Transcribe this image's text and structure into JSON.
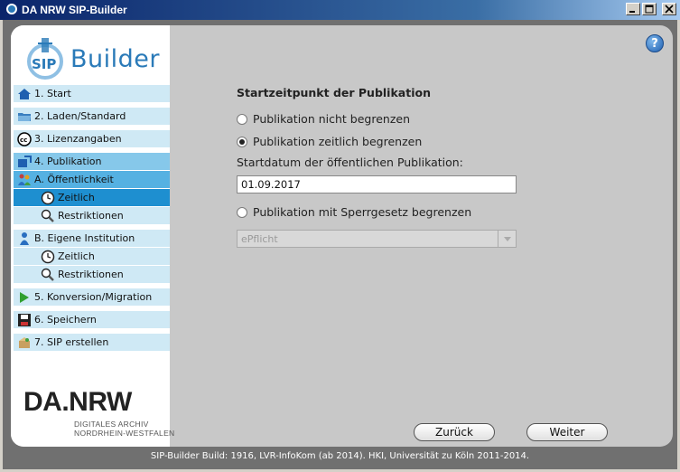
{
  "window": {
    "title": "DA NRW SIP-Builder"
  },
  "sidebar": {
    "logo_text": "Builder",
    "logo_sip": "SIP",
    "items": [
      {
        "label": "1. Start",
        "icon": "house-icon"
      },
      {
        "label": "2. Laden/Standard",
        "icon": "folder-icon"
      },
      {
        "label": "3. Lizenzangaben",
        "icon": "creative-commons-icon"
      },
      {
        "label": "4. Publikation",
        "icon": "publish-icon"
      },
      {
        "label": "A. Öffentlichkeit",
        "icon": "group-icon"
      },
      {
        "label": "Zeitlich",
        "icon": "clock-icon"
      },
      {
        "label": "Restriktionen",
        "icon": "magnifier-icon"
      },
      {
        "label": "B. Eigene Institution",
        "icon": "person-icon"
      },
      {
        "label": "Zeitlich",
        "icon": "clock-icon"
      },
      {
        "label": "Restriktionen",
        "icon": "magnifier-icon"
      },
      {
        "label": "5. Konversion/Migration",
        "icon": "play-icon"
      },
      {
        "label": "6. Speichern",
        "icon": "floppy-icon"
      },
      {
        "label": "7. SIP erstellen",
        "icon": "package-icon"
      }
    ],
    "footer_logo": "DA.NRW",
    "footer_line1": "DIGITALES ARCHIV",
    "footer_line2": "NORDRHEIN-WESTFALEN"
  },
  "main": {
    "help_label": "?",
    "heading": "Startzeitpunkt der Publikation",
    "options": [
      {
        "label": "Publikation nicht begrenzen",
        "selected": false
      },
      {
        "label": "Publikation zeitlich begrenzen",
        "selected": true
      },
      {
        "label": "Publikation mit Sperrgesetz begrenzen",
        "selected": false
      }
    ],
    "date_label": "Startdatum der öffentlichen Publikation:",
    "date_value": "01.09.2017",
    "law_select_value": "ePflicht",
    "back_label": "Zurück",
    "next_label": "Weiter"
  },
  "status": {
    "text": "SIP-Builder Build: 1916, LVR-InfoKom (ab 2014). HKI, Universität zu Köln 2011-2014."
  },
  "colors": {
    "nav_default": "#cfe9f5",
    "nav_section": "#86c8ea",
    "nav_subsection": "#55b1e2",
    "nav_selected": "#1e8fd0",
    "accent": "#2a7ab8"
  }
}
